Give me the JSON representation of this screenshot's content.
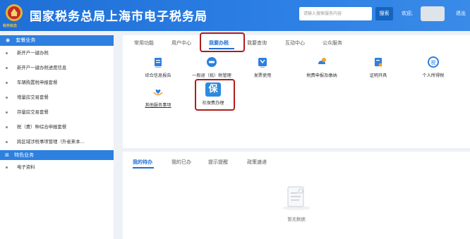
{
  "header": {
    "emblem_caption": "税务标志",
    "title": "国家税务总局上海市电子税务局",
    "search_placeholder": "请输入搜索服务内容",
    "search_button": "搜索",
    "welcome": "欢迎,",
    "logout": "退出"
  },
  "sidebar": {
    "section1": "套餐业务",
    "items": [
      "新开户一键办税",
      "新开户一键办税进度信息",
      "车辆购置税申报套餐",
      "增量房交易套餐",
      "存量房交易套餐",
      "税（费）种综合申报套餐",
      "跨区域涉税事项管理（外省来本…"
    ],
    "section2": "特色业务",
    "items2": [
      "电子资料"
    ]
  },
  "main": {
    "tabs": [
      "常用功能",
      "用户中心",
      "我要办税",
      "我要查询",
      "互动中心",
      "公众服务"
    ],
    "services": [
      {
        "label": "综合信息报告",
        "icon": "report-icon"
      },
      {
        "label": "一般退（抵）税管理",
        "icon": "tax-refund-icon"
      },
      {
        "label": "发票使用",
        "icon": "invoice-icon"
      },
      {
        "label": "税费申报及缴纳",
        "icon": "tax-payment-icon"
      },
      {
        "label": "证明开具",
        "icon": "certificate-icon"
      },
      {
        "label": "个人所得税",
        "icon": "personal-income-tax-icon"
      },
      {
        "label": "其他服务事项",
        "icon": "heart-hands-icon"
      },
      {
        "label": "社保费办理",
        "icon": "social-security-icon",
        "badge": "保"
      }
    ]
  },
  "bottom": {
    "tabs": [
      "我的待办",
      "我的已办",
      "提示提醒",
      "政策速递"
    ],
    "empty": "暂无数据"
  },
  "colors": {
    "header_blue": "#2b7ee3",
    "accent": "#1f6fd6",
    "highlight_red": "#b01c1c"
  }
}
